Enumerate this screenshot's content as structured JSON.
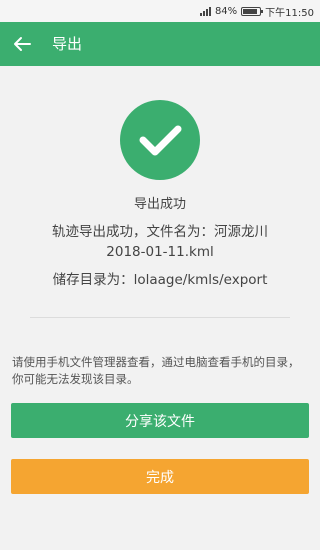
{
  "status_bar": {
    "battery": "84%",
    "time": "下午11:50",
    "battery_level": 0.84
  },
  "app_bar": {
    "title": "导出",
    "back_icon": "arrow-left-icon"
  },
  "result": {
    "icon": "check-circle-icon",
    "title": "导出成功",
    "message_prefix": "轨迹导出成功，文件名为：河源龙川",
    "file_name": "2018-01-11.kml",
    "storage_dir": "储存目录为：lolaage/kmls/export"
  },
  "hint": "请使用手机文件管理器查看，通过电脑查看手机的目录，你可能无法发现该目录。",
  "buttons": {
    "share": "分享该文件",
    "done": "完成"
  },
  "colors": {
    "primary": "#3bae6f",
    "done": "#f5a531",
    "background": "#f2f2f2"
  }
}
